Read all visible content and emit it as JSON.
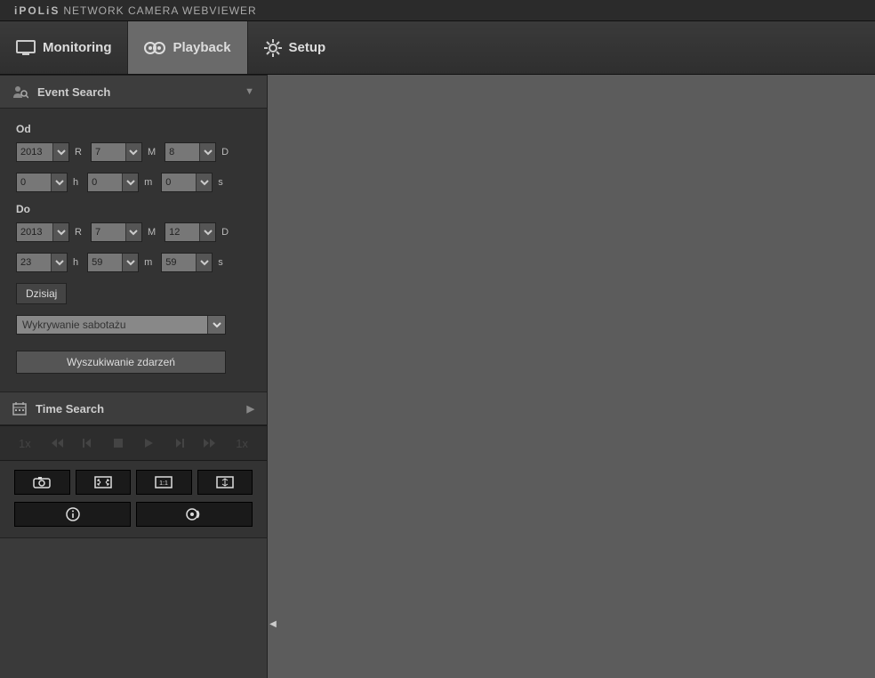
{
  "header": {
    "brand": "iPOLiS",
    "title": "NETWORK CAMERA WEBVIEWER"
  },
  "tabs": {
    "monitoring": "Monitoring",
    "playback": "Playback",
    "setup": "Setup"
  },
  "panels": {
    "event_search": "Event Search",
    "time_search": "Time Search"
  },
  "labels": {
    "from": "Od",
    "to": "Do",
    "year": "R",
    "month": "M",
    "day": "D",
    "hour": "h",
    "minute": "m",
    "second": "s"
  },
  "from": {
    "year": "2013",
    "month": "7",
    "day": "8",
    "hour": "0",
    "minute": "0",
    "second": "0"
  },
  "to": {
    "year": "2013",
    "month": "7",
    "day": "12",
    "hour": "23",
    "minute": "59",
    "second": "59"
  },
  "buttons": {
    "today": "Dzisiaj",
    "search": "Wyszukiwanie zdarzeń"
  },
  "event_type": "Wykrywanie sabotażu",
  "transport": {
    "speed_left": "1x",
    "speed_right": "1x"
  }
}
